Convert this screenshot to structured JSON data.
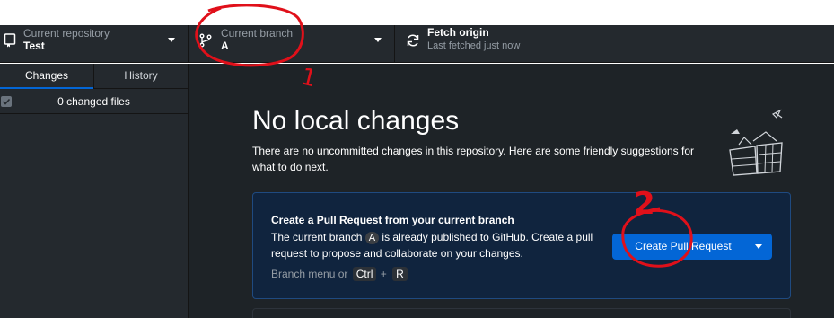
{
  "toolbar": {
    "repository": {
      "label": "Current repository",
      "value": "Test"
    },
    "branch": {
      "label": "Current branch",
      "value": "A"
    },
    "fetch": {
      "label": "Fetch origin",
      "value": "Last fetched just now"
    }
  },
  "sidebar": {
    "tabs": [
      {
        "label": "Changes",
        "active": true
      },
      {
        "label": "History",
        "active": false
      }
    ],
    "changed_files_label": "0 changed files"
  },
  "main": {
    "heading": "No local changes",
    "subtext": "There are no uncommitted changes in this repository. Here are some friendly suggestions for what to do next.",
    "pull_request_card": {
      "title": "Create a Pull Request from your current branch",
      "desc_before": "The current branch",
      "branch_name": "A",
      "desc_after": "is already published to GitHub. Create a pull request to propose and collaborate on your changes.",
      "hint_label": "Branch menu or",
      "shortcut_key_1": "Ctrl",
      "shortcut_plus": "+",
      "shortcut_key_2": "R",
      "button_label": "Create Pull Request"
    }
  },
  "annotations": {
    "mark_1": "1",
    "mark_2": "2",
    "color": "#e0101a"
  },
  "colors": {
    "toolbar_bg": "#24292e",
    "main_bg": "#1e2327",
    "accent": "#0366d6",
    "card_bg": "#10243e"
  }
}
